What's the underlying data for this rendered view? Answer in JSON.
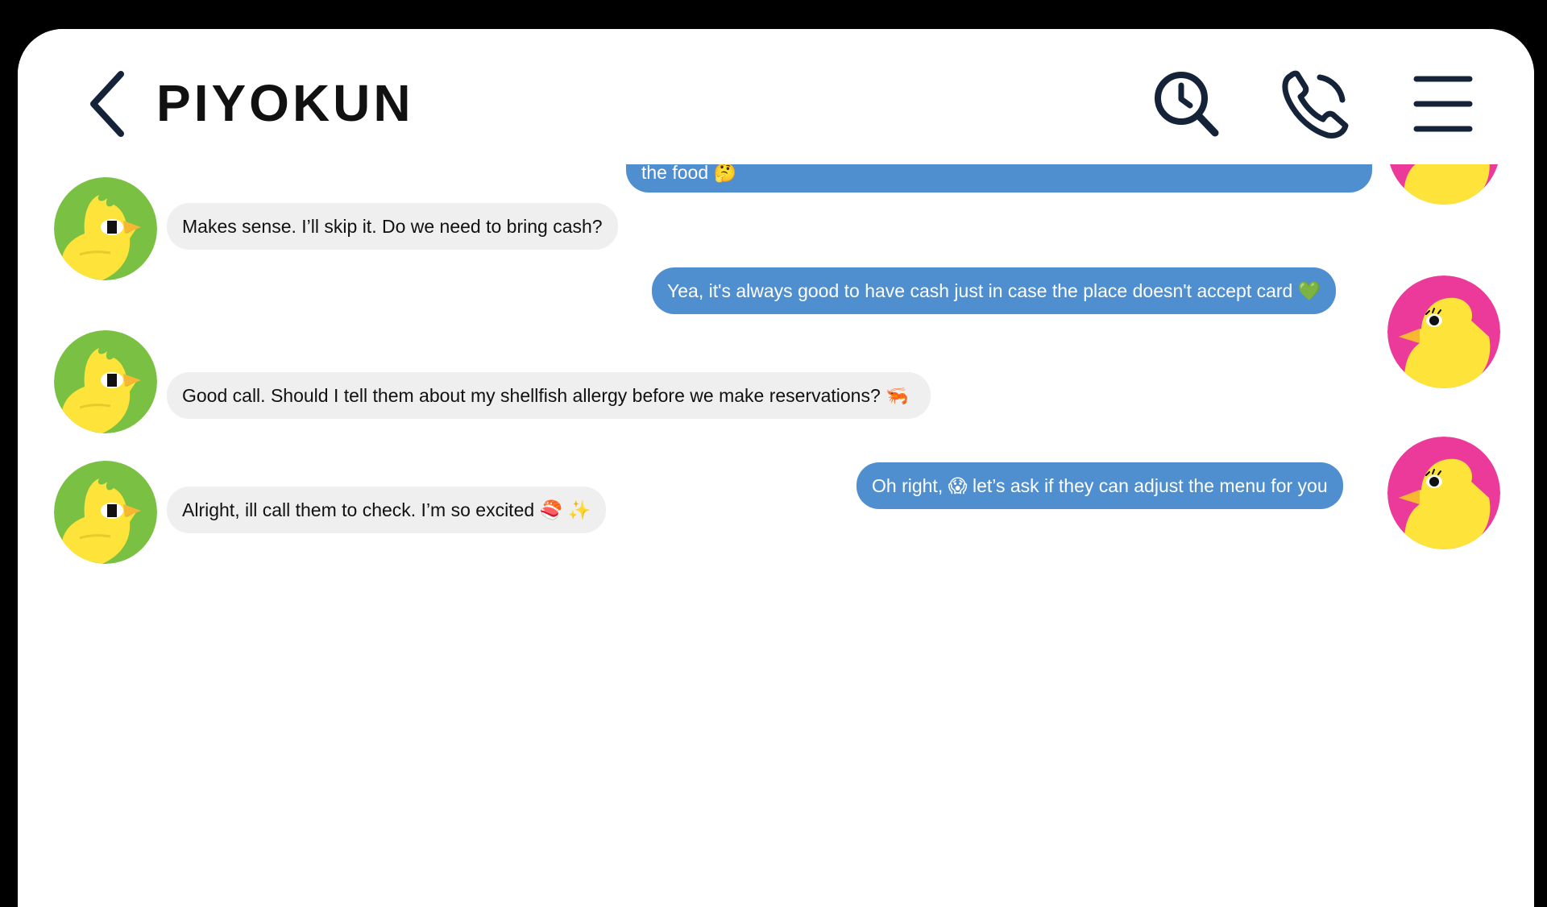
{
  "header": {
    "title": "PIYOKUN",
    "icons": [
      "back-arrow-icon",
      "search-history-icon",
      "phone-icon",
      "menu-icon"
    ]
  },
  "colors": {
    "outgoing_bubble": "#4f8fcf",
    "incoming_bubble": "#efefef",
    "contact_avatar_bg": "#7ac143",
    "self_avatar_bg": "#ec3a9a",
    "chick_yellow": "#fde33a",
    "header_icon": "#152339"
  },
  "messages": [
    {
      "sender": "self",
      "text": "the food 🤔"
    },
    {
      "sender": "contact",
      "text": "Makes sense. I’ll skip it. Do we need to bring cash?"
    },
    {
      "sender": "self",
      "text": "Yea, it's always good to have cash just in case the place doesn't accept card 💚"
    },
    {
      "sender": "contact",
      "text": "Good call. Should I tell them about my shellfish allergy before we make reservations? 🦐"
    },
    {
      "sender": "self",
      "text": "Oh right, 😱 let’s ask if they can adjust the menu for you"
    },
    {
      "sender": "contact",
      "text": "Alright, ill call them to check. I’m so excited 🍣 ✨"
    }
  ]
}
